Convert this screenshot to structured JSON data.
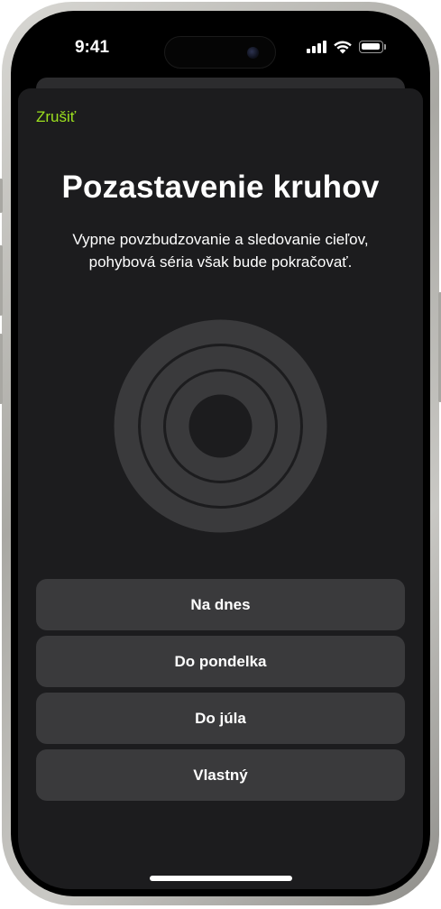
{
  "status_bar": {
    "time": "9:41",
    "icons": [
      "cellular-signal-icon",
      "wifi-icon",
      "battery-icon"
    ]
  },
  "sheet": {
    "cancel_label": "Zrušiť",
    "title": "Pozastavenie kruhov",
    "subtitle_line1": "Vypne povzbudzovanie a sledovanie cieľov,",
    "subtitle_line2": "pohybová séria však bude pokračovať.",
    "graphic": "activity-rings-icon"
  },
  "options": [
    {
      "label": "Na dnes"
    },
    {
      "label": "Do pondelka"
    },
    {
      "label": "Do júla"
    },
    {
      "label": "Vlastný"
    }
  ],
  "colors": {
    "accent": "#9ce01e",
    "sheet_background": "#1c1c1e",
    "button_background": "#3a3a3c",
    "ring_color": "#3a3a3c"
  }
}
